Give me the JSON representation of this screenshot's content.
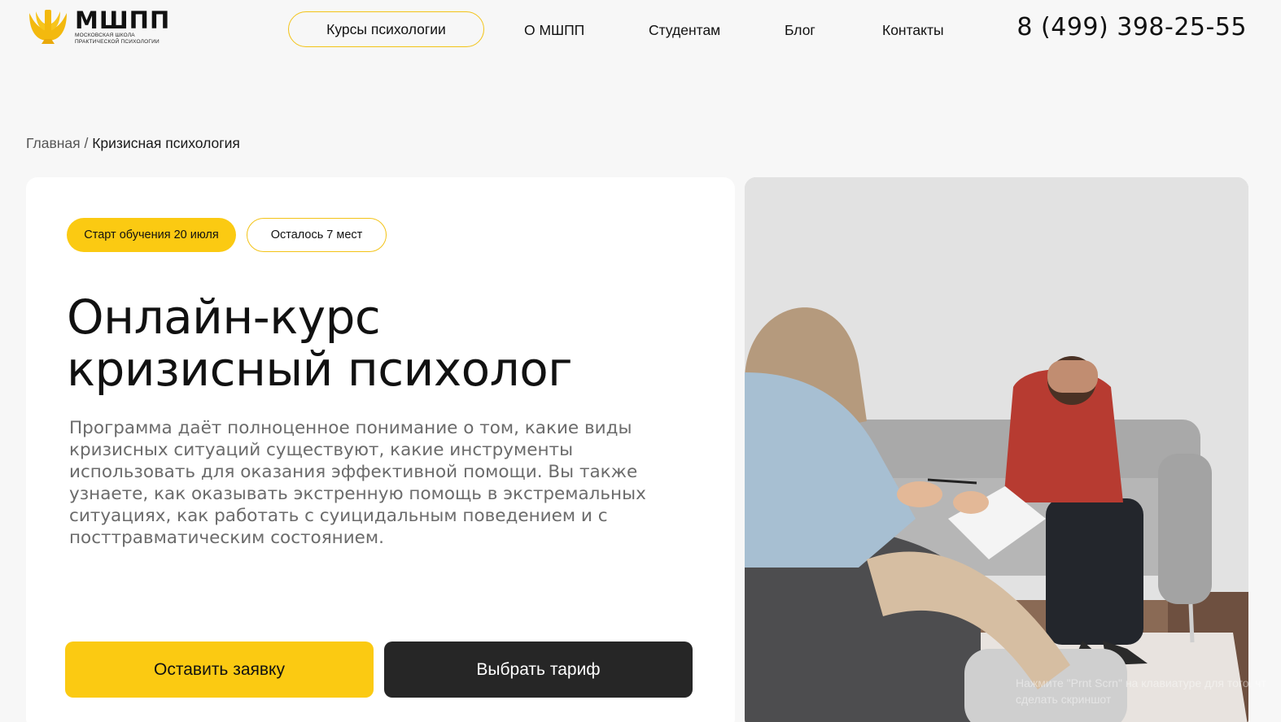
{
  "header": {
    "logo": {
      "name": "МШПП",
      "subtitle_line1": "МОСКОВСКАЯ ШКОЛА",
      "subtitle_line2": "ПРАКТИЧЕСКОЙ ПСИХОЛОГИИ"
    },
    "nav": {
      "courses": "Курсы психологии",
      "about": "О МШПП",
      "students": "Студентам",
      "blog": "Блог",
      "contacts": "Контакты"
    },
    "phone": "8 (499) 398-25-55"
  },
  "breadcrumb": {
    "home": "Главная",
    "separator": "/",
    "current": "Кризисная психология"
  },
  "hero": {
    "badge_start": "Старт обучения 20 июля",
    "badge_seats": "Осталось 7 мест",
    "title_line1": "Онлайн-курс",
    "title_line2": "кризисный психолог",
    "description": "Программа даёт полноценное понимание о том, какие виды кризисных ситуаций существуют, какие инструменты использовать для оказания эффективной помощи. Вы также узнаете, как оказывать экстренную помощь в экстремальных ситуациях, как работать с суицидальным поведением и с посттравматическим состоянием.",
    "button_request": "Оставить заявку",
    "button_tariff": "Выбрать тариф"
  },
  "overlay_hint": {
    "line1": "Нажмите \"Prnt Scrn\" на клавиатуре для того, чт",
    "line2": "сделать скриншот"
  },
  "colors": {
    "accent": "#fbca12",
    "dark": "#262626",
    "background": "#f7f7f7"
  }
}
